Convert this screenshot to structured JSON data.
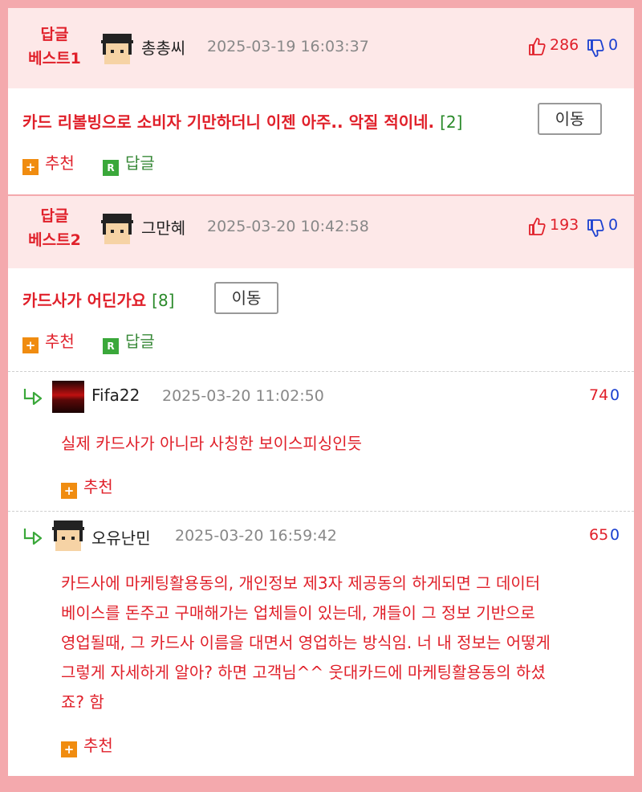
{
  "best1": {
    "label_line1": "답글",
    "label_line2": "베스트1",
    "username": "총총씨",
    "date": "2025-03-19 16:03:37",
    "up_votes": "286",
    "down_votes": "0",
    "title": "카드 리볼빙으로 소비자 기만하더니 이젠 아주.. 악질 적이네.",
    "reply_count": "[2]",
    "move_label": "이동",
    "recommend_label": "추천",
    "reply_label": "답글"
  },
  "best2": {
    "label_line1": "답글",
    "label_line2": "베스트2",
    "username": "그만혜",
    "date": "2025-03-20 10:42:58",
    "up_votes": "193",
    "down_votes": "0",
    "title": "카드사가 어딘가요",
    "reply_count": "[8]",
    "move_label": "이동",
    "recommend_label": "추천",
    "reply_label": "답글"
  },
  "replies": [
    {
      "username": "Fifa22",
      "date": "2025-03-20 11:02:50",
      "score_up": "74",
      "score_down": "0",
      "text": "실제 카드사가 아니라 사칭한 보이스피싱인듯",
      "recommend_label": "추천"
    },
    {
      "username": "오유난민",
      "date": "2025-03-20 16:59:42",
      "score_up": "65",
      "score_down": "0",
      "text_lines": [
        "카드사에 마케팅활용동의, 개인정보 제3자 제공동의 하게되면 그 데이터",
        "베이스를 돈주고 구매해가는 업체들이 있는데, 걔들이 그 정보 기반으로",
        "영업될때, 그 카드사 이름을 대면서 영업하는 방식임. 너 내 정보는 어떻게",
        "그렇게 자세하게 알아? 하면 고객님^^ 웃대카드에 마케팅활용동의 하셨",
        "죠? 함"
      ],
      "recommend_label": "추천"
    }
  ],
  "colors": {
    "accent_red": "#e0202a",
    "vote_blue": "#1a3fd0",
    "best_bg": "#fde8e8",
    "border_pink": "#f4a9ad",
    "count_green": "#2a8a2a"
  },
  "icons": [
    "thumbs-up-icon",
    "thumbs-down-icon",
    "plus-icon",
    "reply-r-icon",
    "reply-arrow-icon",
    "avatar-icon"
  ]
}
